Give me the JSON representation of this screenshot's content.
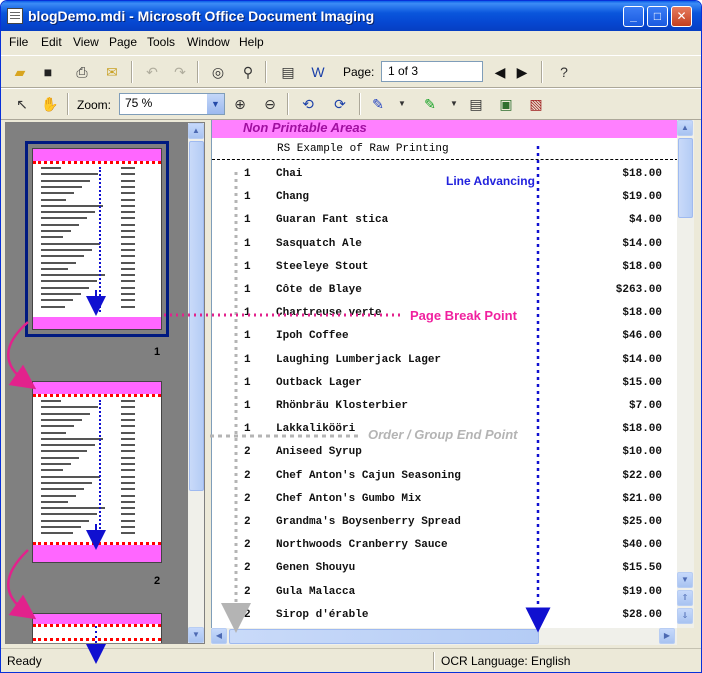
{
  "window": {
    "title": "blogDemo.mdi - Microsoft Office Document Imaging",
    "minimize_glyph": "_",
    "maximize_glyph": "□",
    "close_glyph": "✕"
  },
  "menu": [
    "File",
    "Edit",
    "View",
    "Page",
    "Tools",
    "Window",
    "Help"
  ],
  "toolbar1": {
    "page_label": "Page:",
    "page_value": "1 of 3",
    "icons": [
      "open-icon",
      "save-icon",
      "print-icon",
      "send-icon",
      "undo-icon",
      "redo-icon",
      "ocr-icon",
      "find-icon",
      "scan-icon",
      "send-to-word-icon",
      "previous-page-icon",
      "next-page-icon",
      "help-icon"
    ]
  },
  "toolbar2": {
    "zoom_label": "Zoom:",
    "zoom_value": "75 %",
    "icons": [
      "select-pointer-icon",
      "pan-hand-icon",
      "zoom-in-icon",
      "zoom-out-icon",
      "rotate-left-icon",
      "rotate-right-icon",
      "pen-icon",
      "highlighter-icon",
      "text-box-icon",
      "picture-icon",
      "reading-mode-icon"
    ]
  },
  "thumbnails": {
    "page_numbers": [
      "1",
      "2"
    ]
  },
  "document": {
    "non_printable_label": "Non Printable Areas",
    "report_title": "RS Example of Raw Printing",
    "rows": [
      {
        "qty": "1",
        "name": "Chai",
        "price": "$18.00"
      },
      {
        "qty": "1",
        "name": "Chang",
        "price": "$19.00"
      },
      {
        "qty": "1",
        "name": "Guaran  Fant stica",
        "price": "$4.00"
      },
      {
        "qty": "1",
        "name": "Sasquatch Ale",
        "price": "$14.00"
      },
      {
        "qty": "1",
        "name": "Steeleye Stout",
        "price": "$18.00"
      },
      {
        "qty": "1",
        "name": "Côte de Blaye",
        "price": "$263.00"
      },
      {
        "qty": "1",
        "name": "Chartreuse verte",
        "price": "$18.00"
      },
      {
        "qty": "1",
        "name": "Ipoh Coffee",
        "price": "$46.00"
      },
      {
        "qty": "1",
        "name": "Laughing Lumberjack Lager",
        "price": "$14.00"
      },
      {
        "qty": "1",
        "name": "Outback Lager",
        "price": "$15.00"
      },
      {
        "qty": "1",
        "name": "Rhönbräu Klosterbier",
        "price": "$7.00"
      },
      {
        "qty": "1",
        "name": "Lakkalikööri",
        "price": "$18.00"
      },
      {
        "qty": "2",
        "name": "Aniseed Syrup",
        "price": "$10.00"
      },
      {
        "qty": "2",
        "name": "Chef Anton's Cajun Seasoning",
        "price": "$22.00"
      },
      {
        "qty": "2",
        "name": "Chef Anton's Gumbo Mix",
        "price": "$21.00"
      },
      {
        "qty": "2",
        "name": "Grandma's Boysenberry Spread",
        "price": "$25.00"
      },
      {
        "qty": "2",
        "name": "Northwoods Cranberry Sauce",
        "price": "$40.00"
      },
      {
        "qty": "2",
        "name": "Genen Shouyu",
        "price": "$15.50"
      },
      {
        "qty": "2",
        "name": "Gula Malacca",
        "price": "$19.00"
      },
      {
        "qty": "2",
        "name": "Sirop d'érable",
        "price": "$28.00"
      }
    ],
    "annotations": {
      "line_advancing": "Line Advancing",
      "page_break_point": "Page Break Point",
      "group_end_point": "Order / Group End Point"
    }
  },
  "status": {
    "left": "Ready",
    "right": "OCR Language: English"
  },
  "colors": {
    "non_printable_band": "#ff80ff",
    "page_break": "#ff0000",
    "line_advancing": "#1010d0",
    "group_end": "#b4b4b4",
    "page_break_label": "#f0209f"
  }
}
